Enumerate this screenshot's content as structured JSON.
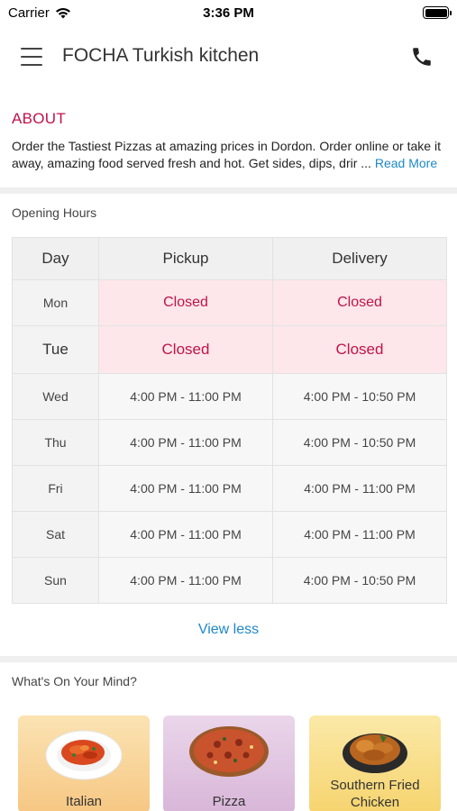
{
  "status_bar": {
    "carrier": "Carrier",
    "time": "3:36 PM",
    "icons": [
      "wifi-icon",
      "battery-icon"
    ]
  },
  "nav": {
    "title": "FOCHA Turkish kitchen",
    "icons": [
      "menu-icon",
      "phone-icon"
    ]
  },
  "about": {
    "title": "ABOUT",
    "text": "Order the Tastiest Pizzas at amazing prices in Dordon. Order online or take it away, amazing food served fresh and hot. Get sides, dips, drir ...",
    "read_more": "Read More"
  },
  "opening_hours": {
    "title": "Opening Hours",
    "headers": [
      "Day",
      "Pickup",
      "Delivery"
    ],
    "rows": [
      {
        "day": "Mon",
        "pickup": "Closed",
        "delivery": "Closed",
        "closed": true
      },
      {
        "day": "Tue",
        "pickup": "Closed",
        "delivery": "Closed",
        "closed": true
      },
      {
        "day": "Wed",
        "pickup": "4:00 PM - 11:00 PM",
        "delivery": "4:00 PM - 10:50 PM",
        "closed": false
      },
      {
        "day": "Thu",
        "pickup": "4:00 PM - 11:00 PM",
        "delivery": "4:00 PM - 10:50 PM",
        "closed": false
      },
      {
        "day": "Fri",
        "pickup": "4:00 PM - 11:00 PM",
        "delivery": "4:00 PM - 11:00 PM",
        "closed": false
      },
      {
        "day": "Sat",
        "pickup": "4:00 PM - 11:00 PM",
        "delivery": "4:00 PM - 11:00 PM",
        "closed": false
      },
      {
        "day": "Sun",
        "pickup": "4:00 PM - 11:00 PM",
        "delivery": "4:00 PM - 10:50 PM",
        "closed": false
      }
    ],
    "view_less": "View less"
  },
  "whats_on_mind": {
    "title": "What's On Your Mind?",
    "categories": [
      {
        "label": "Italian",
        "image": "pasta-plate-image"
      },
      {
        "label": "Pizza",
        "image": "pizza-image"
      },
      {
        "label": "Southern Fried Chicken",
        "image": "fried-chicken-image"
      }
    ]
  },
  "colors": {
    "accent": "#c0134a",
    "link": "#1e88c9",
    "closed_bg": "#fde7ea",
    "divider": "#efefef"
  }
}
